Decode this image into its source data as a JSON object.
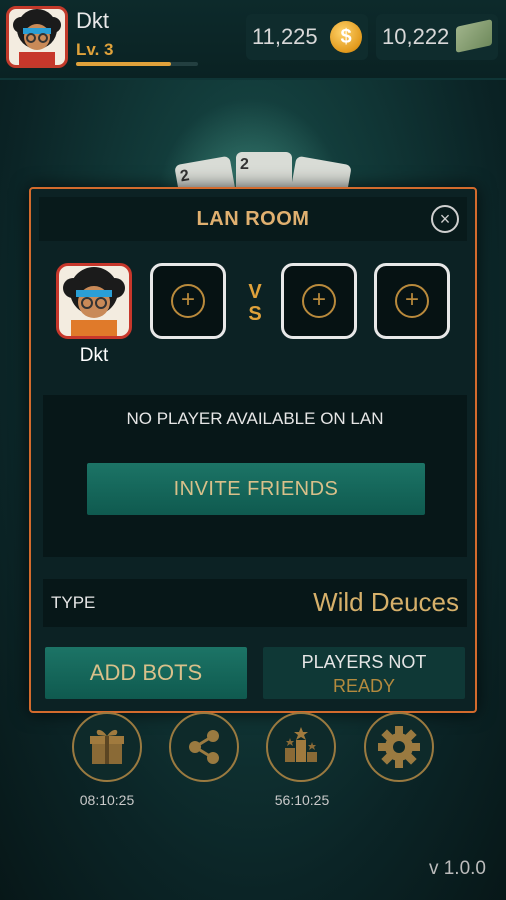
{
  "profile": {
    "name": "Dkt",
    "level": "Lv. 3",
    "xp_fraction": 0.78
  },
  "currency": {
    "coins": "11,225",
    "cash": "10,222"
  },
  "modal": {
    "title": "LAN ROOM",
    "player_name": "Dkt",
    "vs_top": "V",
    "vs_bottom": "S",
    "lan_message": "NO PLAYER AVAILABLE ON LAN",
    "invite_label": "INVITE FRIENDS",
    "type_label": "TYPE",
    "type_value": "Wild Deuces",
    "add_bots_label": "ADD BOTS",
    "not_ready_line1": "PLAYERS NOT",
    "not_ready_line2": "READY"
  },
  "bottom": {
    "gift_timer": "08:10:25",
    "leaderboard_timer": "56:10:25"
  },
  "icons": {
    "coin": "coin-icon",
    "cash": "cash-icon",
    "close": "close-icon",
    "gift": "gift-icon",
    "share": "share-icon",
    "leaderboard": "leaderboard-icon",
    "settings": "gear-icon"
  },
  "colors": {
    "accent": "#e0a23b",
    "button": "#1c7466",
    "border": "#d36b2d",
    "avatar_border": "#c23a2b"
  },
  "version": "v 1.0.0"
}
